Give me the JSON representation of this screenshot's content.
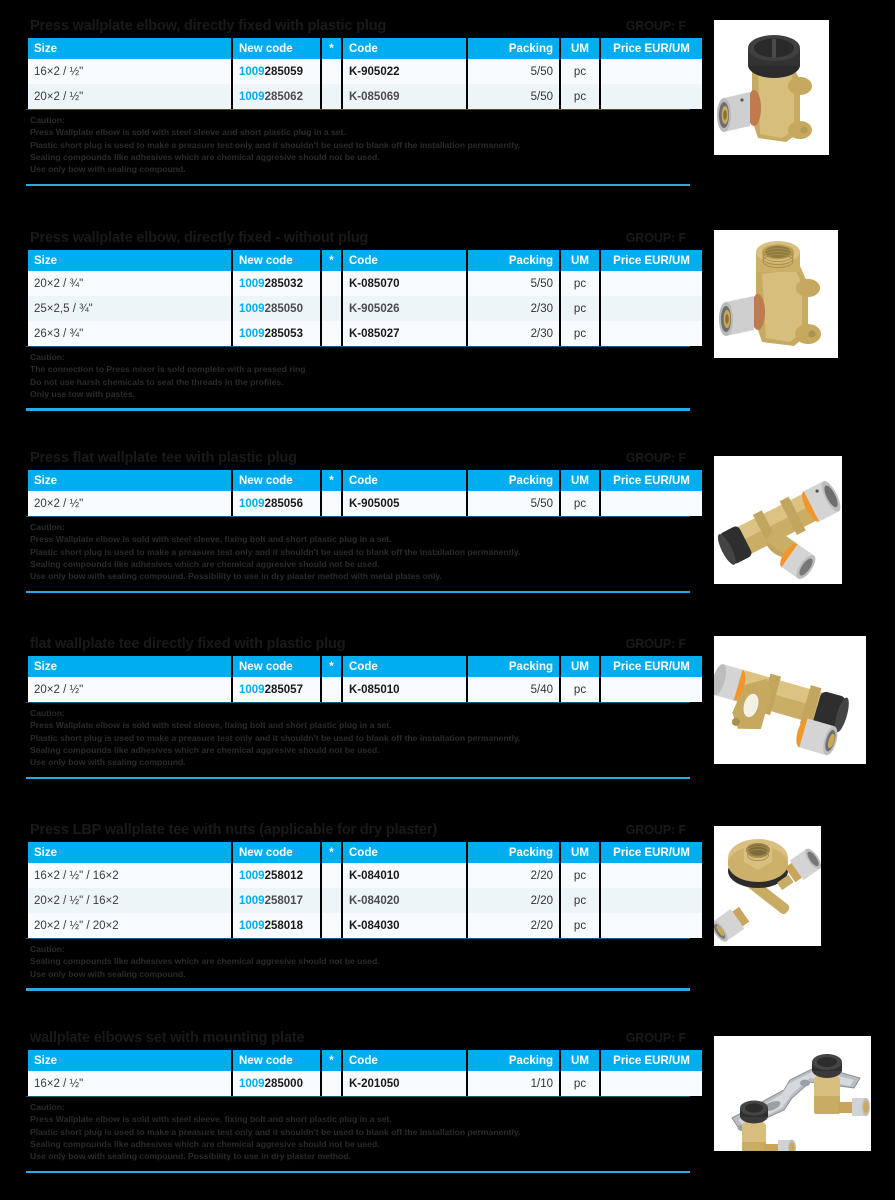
{
  "table": {
    "columns": [
      "Size",
      "New code",
      "*",
      "Code",
      "Packing",
      "UM",
      "Price EUR/UM"
    ]
  },
  "colors": {
    "header_blue": "#00AEEF",
    "rule_blue": "#29ABE2",
    "code_prefix_blue": "#00AEEF",
    "page_background": "#000000",
    "row_background": "#F7FBFD"
  },
  "sections": [
    {
      "title": "Press wallplate elbow, directly fixed with plastic plug",
      "group": "GROUP: F",
      "rows": [
        {
          "size": "16×2 / ½\"",
          "prefix": "1009",
          "newcode": "285059",
          "star": "",
          "code": "K-905022",
          "packing": "5/50",
          "um": "pc",
          "price": ""
        },
        {
          "size": "20×2 / ½\"",
          "prefix": "1009",
          "newcode": "285062",
          "star": "",
          "code": "K-085069",
          "packing": "5/50",
          "um": "pc",
          "price": ""
        }
      ],
      "caution_head": "Caution:",
      "caution_lines": [
        "Press Wallplate elbow is sold with steel sleeve and short plastic plug in a set.",
        "Plastic short plug is used to make a preasure test only and it shouldn't be used to blank off the installation permanently.",
        "Sealing compounds like adhesives which are chemical aggresive should not be used.",
        "Use only bow with sealing compound."
      ],
      "photo": "press-wallplate-elbow-with-plug"
    },
    {
      "title": "Press wallplate elbow, directly fixed - without plug",
      "group": "GROUP: F",
      "rows": [
        {
          "size": "20×2 / ¾\"",
          "prefix": "1009",
          "newcode": "285032",
          "star": "",
          "code": "K-085070",
          "packing": "5/50",
          "um": "pc",
          "price": ""
        },
        {
          "size": "25×2,5 / ¾\"",
          "prefix": "1009",
          "newcode": "285050",
          "star": "",
          "code": "K-905026",
          "packing": "2/30",
          "um": "pc",
          "price": ""
        },
        {
          "size": "26×3 / ¾\"",
          "prefix": "1009",
          "newcode": "285053",
          "star": "",
          "code": "K-085027",
          "packing": "2/30",
          "um": "pc",
          "price": ""
        }
      ],
      "caution_head": "Caution:",
      "caution_lines": [
        "The connection to Press mixer is sold complete with a pressed ring",
        "Do not use harsh chemicals to seal the threads in the profiles.",
        "Only use tow with pastes."
      ],
      "photo": "press-wallplate-elbow-without-plug"
    },
    {
      "title": "Press flat wallplate tee with plastic plug",
      "group": "GROUP: F",
      "rows": [
        {
          "size": "20×2 / ½\"",
          "prefix": "1009",
          "newcode": "285056",
          "star": "",
          "code": "K-905005",
          "packing": "5/50",
          "um": "pc",
          "price": ""
        }
      ],
      "caution_head": "Caution:",
      "caution_lines": [
        "Press Wallplate elbow is sold with steel sleeve, fixing bolt and short plastic plug in a set.",
        "Plastic short plug is used to make a preasure test only and it shouldn't be used to blank off the installation permanently.",
        "Sealing compounds like adhesives which are chemical aggresive should not be used.",
        "Use only bow with sealing compound. Possibility to use in dry plaster method with metal plates only."
      ],
      "photo": "press-flat-wallplate-tee-with-plug"
    },
    {
      "title": "flat wallplate tee directly fixed with plastic plug",
      "group": "GROUP: F",
      "rows": [
        {
          "size": "20×2 / ½\"",
          "prefix": "1009",
          "newcode": "285057",
          "star": "",
          "code": "K-085010",
          "packing": "5/40",
          "um": "pc",
          "price": ""
        }
      ],
      "caution_head": "Caution:",
      "caution_lines": [
        "Press Wallplate elbow is sold with steel sleeve, fixing bolt and short plastic plug in a set.",
        "Plastic short plug is used to make a preasure test only and it shouldn't be used to blank off the installation permanently.",
        "Sealing compounds like adhesives which are chemical aggresive should not be used.",
        "Use only bow with sealing compound."
      ],
      "photo": "flat-wallplate-tee-directly-fixed"
    },
    {
      "title": "Press LBP wallplate tee with nuts (applicable for dry plaster)",
      "group": "GROUP: F",
      "rows": [
        {
          "size": "16×2 / ½\" / 16×2",
          "prefix": "1009",
          "newcode": "258012",
          "star": "",
          "code": "K-084010",
          "packing": "2/20",
          "um": "pc",
          "price": ""
        },
        {
          "size": "20×2 / ½\" / 16×2",
          "prefix": "1009",
          "newcode": "258017",
          "star": "",
          "code": "K-084020",
          "packing": "2/20",
          "um": "pc",
          "price": ""
        },
        {
          "size": "20×2 / ½\" / 20×2",
          "prefix": "1009",
          "newcode": "258018",
          "star": "",
          "code": "K-084030",
          "packing": "2/20",
          "um": "pc",
          "price": ""
        }
      ],
      "caution_head": "Caution:",
      "caution_lines": [
        "Sealing compounds like adhesives which are chemical aggresive should not be used.",
        "Use only bow with sealing compound."
      ],
      "photo": "press-lbp-wallplate-tee-with-nuts"
    },
    {
      "title": "wallplate elbows set with mounting plate",
      "group": "GROUP: F",
      "rows": [
        {
          "size": "16×2 / ½\"",
          "prefix": "1009",
          "newcode": "285000",
          "star": "",
          "code": "K-201050",
          "packing": "1/10",
          "um": "pc",
          "price": ""
        }
      ],
      "caution_head": "Caution:",
      "caution_lines": [
        "Press Wallplate elbow is sold with steel sleeve, fixing bolt and short plastic plug in a set.",
        "Plastic short plug is used to make a preasure test only and it shouldn't be used to blank off the installation permanently.",
        "Sealing compounds like adhesives which are chemical aggresive should not be used.",
        "Use only bow with sealing compound. Possibility to use in dry plaster method."
      ],
      "photo": "wallplate-elbows-set-with-mounting-plate"
    }
  ]
}
